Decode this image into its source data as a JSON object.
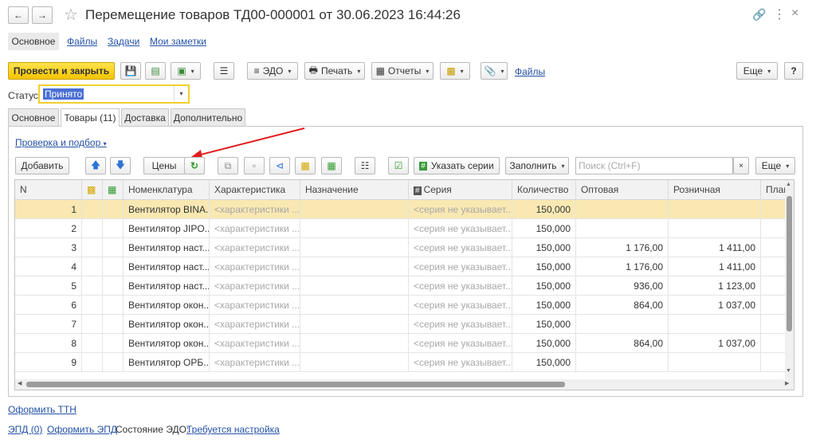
{
  "window": {
    "title": "Перемещение товаров ТД00-000001 от 30.06.2023 16:44:26"
  },
  "top_nav": [
    "Основное",
    "Файлы",
    "Задачи",
    "Мои заметки"
  ],
  "toolbar": {
    "post_close": "Провести и закрыть",
    "edo": "ЭДО",
    "print": "Печать",
    "reports": "Отчеты",
    "files_link": "Файлы",
    "more": "Еще",
    "help": "?"
  },
  "status": {
    "label": "Статус:",
    "value": "Принято"
  },
  "tabs": [
    "Основное",
    "Товары (11)",
    "Доставка",
    "Дополнительно"
  ],
  "check_link": "Проверка и подбор",
  "table_toolbar": {
    "add": "Добавить",
    "prices": "Цены",
    "specify_series": "Указать серии",
    "fill": "Заполнить",
    "search_placeholder": "Поиск (Ctrl+F)",
    "more": "Еще"
  },
  "columns": [
    "N",
    "Номенклатура",
    "Характеристика",
    "Назначение",
    "Серия",
    "Количество",
    "Оптовая",
    "Розничная",
    "План"
  ],
  "rows": [
    {
      "n": "1",
      "item": "Вентилятор BINA...",
      "char": "<характеристики ...",
      "series": "<серия не указывает...",
      "qty": "150,000",
      "wholesale": "",
      "retail": ""
    },
    {
      "n": "2",
      "item": "Вентилятор JIPO...",
      "char": "<характеристики ...",
      "series": "<серия не указывает...",
      "qty": "150,000",
      "wholesale": "",
      "retail": ""
    },
    {
      "n": "3",
      "item": "Вентилятор наст...",
      "char": "<характеристики ...",
      "series": "<серия не указывает...",
      "qty": "150,000",
      "wholesale": "1 176,00",
      "retail": "1 411,00"
    },
    {
      "n": "4",
      "item": "Вентилятор наст...",
      "char": "<характеристики ...",
      "series": "<серия не указывает...",
      "qty": "150,000",
      "wholesale": "1 176,00",
      "retail": "1 411,00"
    },
    {
      "n": "5",
      "item": "Вентилятор наст...",
      "char": "<характеристики ...",
      "series": "<серия не указывает...",
      "qty": "150,000",
      "wholesale": "936,00",
      "retail": "1 123,00"
    },
    {
      "n": "6",
      "item": "Вентилятор окон...",
      "char": "<характеристики ...",
      "series": "<серия не указывает...",
      "qty": "150,000",
      "wholesale": "864,00",
      "retail": "1 037,00"
    },
    {
      "n": "7",
      "item": "Вентилятор окон...",
      "char": "<характеристики ...",
      "series": "<серия не указывает...",
      "qty": "150,000",
      "wholesale": "",
      "retail": ""
    },
    {
      "n": "8",
      "item": "Вентилятор окон...",
      "char": "<характеристики ...",
      "series": "<серия не указывает...",
      "qty": "150,000",
      "wholesale": "864,00",
      "retail": "1 037,00"
    },
    {
      "n": "9",
      "item": "Вентилятор ОРБ...",
      "char": "<характеристики ...",
      "series": "<серия не указывает...",
      "qty": "150,000",
      "wholesale": "",
      "retail": ""
    }
  ],
  "footer": {
    "ttn": "Оформить ТТН",
    "edo_count": "ЭПД (0)",
    "make_edo": "Оформить ЭПД",
    "edo_state_label": "Состояние ЭДО:",
    "edo_state_value": "Требуется настройка"
  }
}
